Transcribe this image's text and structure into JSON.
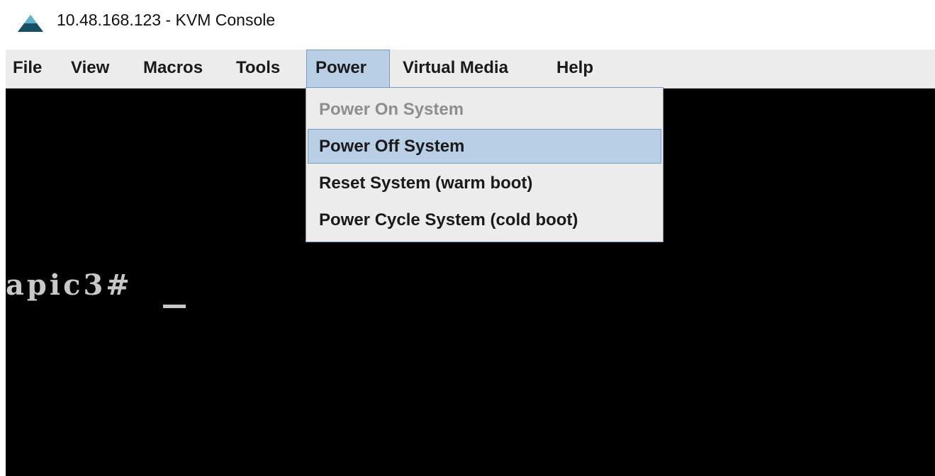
{
  "window": {
    "title": "10.48.168.123 - KVM Console",
    "icon": "triangle-logo-icon"
  },
  "menubar": {
    "items": [
      {
        "label": "File"
      },
      {
        "label": "View"
      },
      {
        "label": "Macros"
      },
      {
        "label": "Tools"
      },
      {
        "label": "Power",
        "active": true
      },
      {
        "label": "Virtual Media"
      },
      {
        "label": "Help"
      }
    ]
  },
  "power_menu": {
    "items": [
      {
        "label": "Power On System",
        "state": "disabled"
      },
      {
        "label": "Power Off System",
        "state": "highlighted"
      },
      {
        "label": "Reset System (warm boot)",
        "state": "normal"
      },
      {
        "label": "Power Cycle System (cold boot)",
        "state": "normal"
      }
    ]
  },
  "console": {
    "prompt": "apic3#"
  },
  "colors": {
    "menu_bg": "#ececec",
    "highlight_bg": "#b8cfe5",
    "highlight_border": "#7c9bbd",
    "console_bg": "#000000",
    "console_text": "#c8c8c8",
    "disabled_text": "#8e8e8e"
  }
}
